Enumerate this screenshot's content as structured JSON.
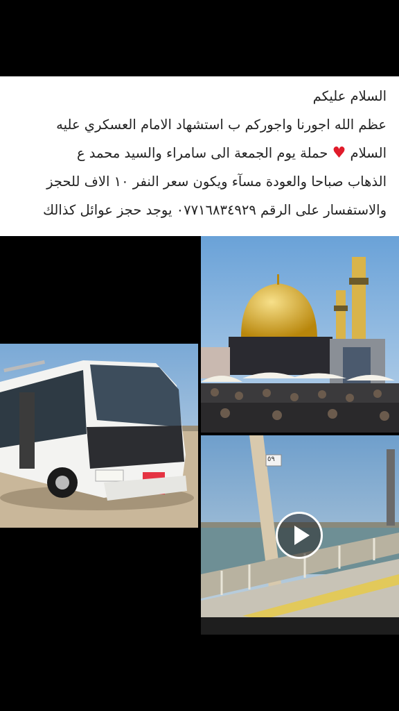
{
  "post": {
    "lines": [
      "السلام عليكم",
      "عظم الله اجورنا واجوركم ب استشهاد الامام العسكري عليه",
      "حملة يوم الجمعة الى سامراء والسيد محمد ع",
      "الذهاب صباحا والعودة مسآء ويكون سعر النفر ١٠ الاف للحجز",
      "والاستفسار على الرقم ٠٧٧١٦٨٣٤٩٢٩ يوجد حجز عوائل كذالك"
    ],
    "line3_prefix": "السلام",
    "heart_icon": "red-heart-icon",
    "heart_color": "#e01b2a"
  },
  "media": {
    "bridge_sign": "٥٩",
    "play_icon": "play-icon"
  }
}
